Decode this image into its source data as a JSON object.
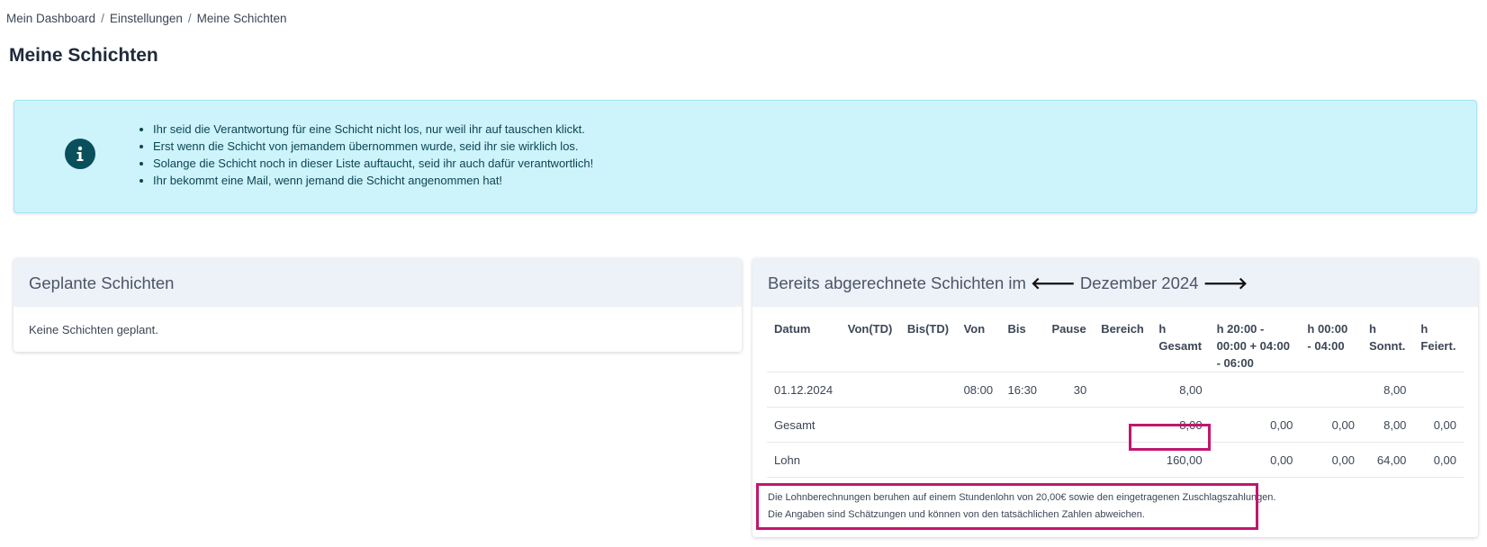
{
  "breadcrumb": {
    "items": [
      "Mein Dashboard",
      "Einstellungen",
      "Meine Schichten"
    ],
    "separator": "/"
  },
  "page": {
    "title": "Meine Schichten"
  },
  "alert": {
    "icon": "info-icon",
    "lines": [
      "Ihr seid die Verantwortung für eine Schicht nicht los, nur weil ihr auf tauschen klickt.",
      "Erst wenn die Schicht von jemandem übernommen wurde, seid ihr sie wirklich los.",
      "Solange die Schicht noch in dieser Liste auftaucht, seid ihr auch dafür verantwortlich!",
      "Ihr bekommt eine Mail, wenn jemand die Schicht angenommen hat!"
    ]
  },
  "planned": {
    "title": "Geplante Schichten",
    "empty_text": "Keine Schichten geplant."
  },
  "billed": {
    "title_prefix": "Bereits abgerechnete Schichten im",
    "prev_arrow": "🡐",
    "month": "Dezember 2024",
    "next_arrow": "🡒",
    "columns": [
      "Datum",
      "Von(TD)",
      "Bis(TD)",
      "Von",
      "Bis",
      "Pause",
      "Bereich",
      "h Gesamt",
      "h 20:00 - 00:00 + 04:00 - 06:00",
      "h 00:00 - 04:00",
      "h Sonnt.",
      "h Feiert."
    ],
    "rows": [
      {
        "datum": "01.12.2024",
        "von_td": "",
        "bis_td": "",
        "von": "08:00",
        "bis": "16:30",
        "pause": "30",
        "bereich": "",
        "h_gesamt": "8,00",
        "h_nacht1": "",
        "h_nacht2": "",
        "h_sonnt": "8,00",
        "h_feiert": ""
      }
    ],
    "summary": {
      "gesamt": {
        "label": "Gesamt",
        "h_gesamt": "8,00",
        "h_nacht1": "0,00",
        "h_nacht2": "0,00",
        "h_sonnt": "8,00",
        "h_feiert": "0,00"
      },
      "lohn": {
        "label": "Lohn",
        "h_gesamt": "160,00",
        "h_nacht1": "0,00",
        "h_nacht2": "0,00",
        "h_sonnt": "64,00",
        "h_feiert": "0,00"
      }
    },
    "footnote": [
      "Die Lohnberechnungen beruhen auf einem Stundenlohn von 20,00€ sowie den eingetragenen Zuschlagszahlungen.",
      "Die Angaben sind Schätzungen und können von den tatsächlichen Zahlen abweichen."
    ]
  },
  "colors": {
    "highlight": "#c2166e",
    "alert_bg": "#cdf3fb",
    "icon_bg": "#0a4f5c",
    "header_bg": "#edf1f8"
  }
}
